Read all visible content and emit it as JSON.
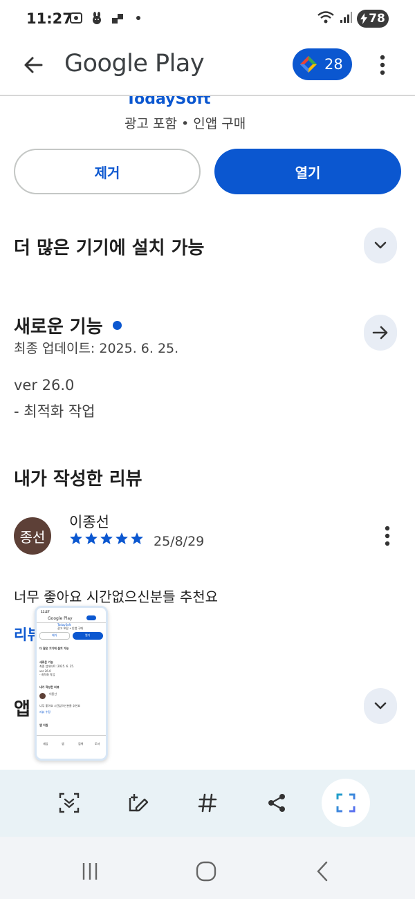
{
  "status_bar": {
    "time": "11:27",
    "battery": "78"
  },
  "app_bar": {
    "title": "Google Play",
    "points": "28"
  },
  "app_info": {
    "developer": "TodaySoft",
    "meta": "광고 포함 • 인앱 구매"
  },
  "actions": {
    "remove_label": "제거",
    "open_label": "열기"
  },
  "sections": {
    "more_devices": "더 많은 기기에 설치 가능",
    "whats_new": {
      "title": "새로운 기능",
      "updated": "최종 업데이트: 2025. 6. 25.",
      "version": "ver 26.0",
      "note": "- 최적화 작업"
    },
    "my_review": {
      "title": "내가 작성한 리뷰",
      "avatar_text": "종선",
      "reviewer": "이종선",
      "rating": 5,
      "date": "25/8/29",
      "text": "너무 좋아요 시간없으신분들 추천요",
      "link_partial": "리뷰"
    },
    "app_support_partial": "앱"
  },
  "thumbnail": {
    "time": "11:27",
    "title": "Google Play",
    "dev": "TodaySoft",
    "meta": "광고 포함 • 인앱 구매",
    "remove": "제거",
    "open": "열기",
    "more_devices": "더 많은 기기에 설치 가능",
    "whats_new": "새로운 기능",
    "updated": "최종 업데이트: 2025. 6. 25.",
    "version": "ver 26.0",
    "note": "- 최적화 작업",
    "my_review": "내가 작성한 리뷰",
    "reviewer": "이종선",
    "review_text": "너무 좋아요 시간없으신분들 추천요",
    "link": "리뷰 수정",
    "app_support": "앱 지원",
    "tabs": [
      "게임",
      "앱",
      "검색",
      "도서"
    ]
  },
  "toolbar": {
    "items": [
      "scroll-capture",
      "tag-edit",
      "hashtag",
      "share",
      "crop"
    ]
  },
  "colors": {
    "accent": "#0b57d0",
    "avatar": "#5d4037",
    "toolbar_bg": "#e8f1f6"
  }
}
